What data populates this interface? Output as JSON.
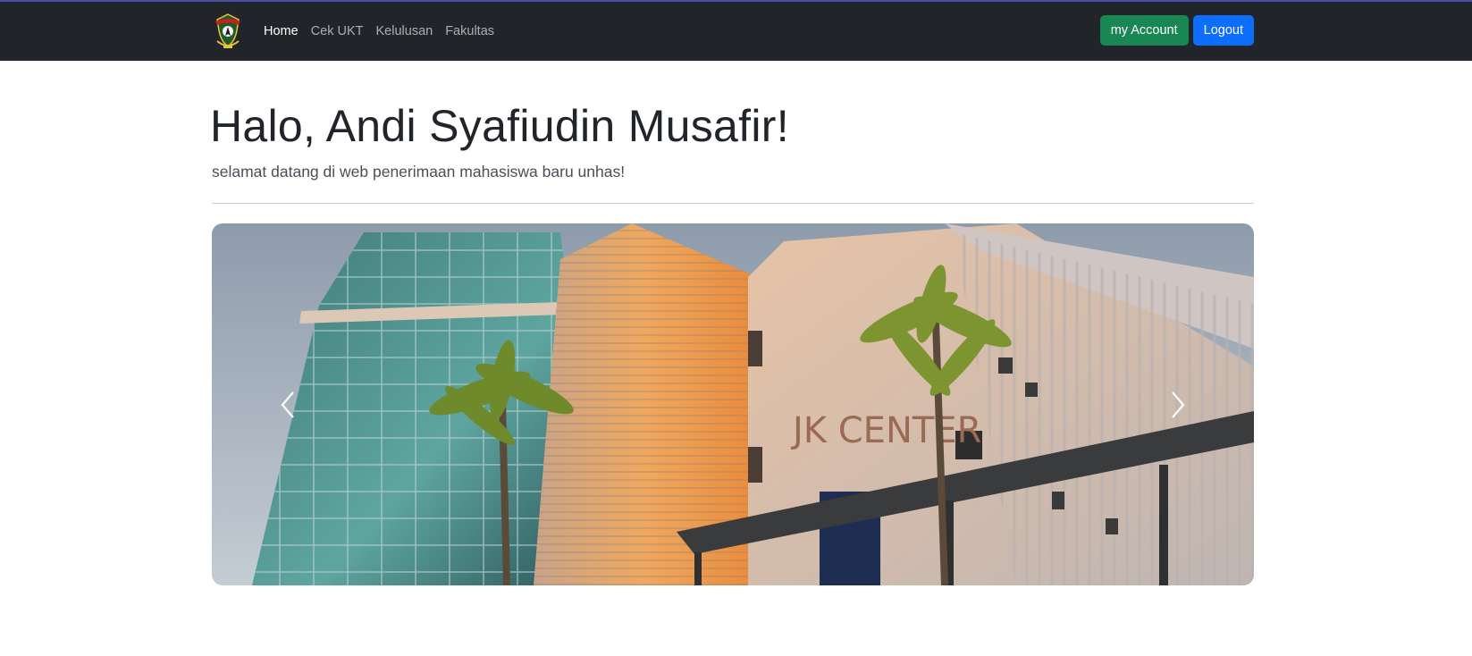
{
  "navbar": {
    "links": [
      {
        "label": "Home",
        "active": true
      },
      {
        "label": "Cek UKT",
        "active": false
      },
      {
        "label": "Kelulusan",
        "active": false
      },
      {
        "label": "Fakultas",
        "active": false
      }
    ],
    "account_button": "my Account",
    "logout_button": "Logout",
    "logo_icon": "university-crest-icon"
  },
  "hero": {
    "title": "Halo, Andi Syafiudin Musafir!",
    "subtitle": "selamat datang di web penerimaan mahasiswa baru unhas!"
  },
  "carousel": {
    "signage_text": "JK CENTER",
    "prev_icon": "chevron-left-icon",
    "next_icon": "chevron-right-icon"
  },
  "colors": {
    "navbar_bg": "#212529",
    "account_button": "#198754",
    "logout_button": "#0d6efd"
  }
}
